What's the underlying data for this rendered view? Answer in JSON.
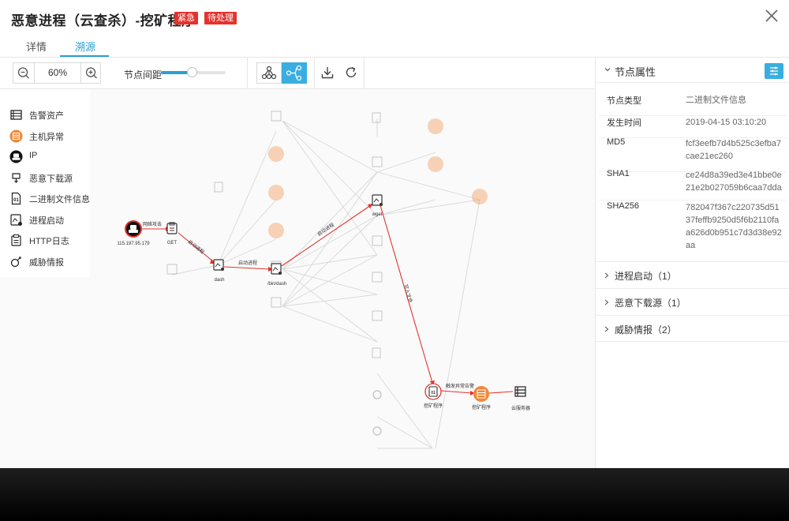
{
  "header": {
    "title": "恶意进程（云查杀）-挖矿程序",
    "tag_urgent": "紧急",
    "tag_pending": "待处理",
    "close_icon": "close-icon"
  },
  "tabs": [
    {
      "label": "详情",
      "active": false
    },
    {
      "label": "溯源",
      "active": true
    }
  ],
  "toolbar": {
    "zoom_value": "60%",
    "spacing_label": "节点间距",
    "slider_fraction": 0.48,
    "icons": [
      "zoom-out-icon",
      "zoom-in-icon",
      "tree-layout-icon",
      "graph-layout-icon",
      "download-icon",
      "refresh-icon"
    ]
  },
  "legend": [
    {
      "label": "告警资产",
      "icon": "asset-icon"
    },
    {
      "label": "主机异常",
      "icon": "host-anomaly-icon"
    },
    {
      "label": "IP",
      "icon": "ip-icon"
    },
    {
      "label": "恶意下载源",
      "icon": "download-source-icon"
    },
    {
      "label": "二进制文件信息",
      "icon": "binary-file-icon"
    },
    {
      "label": "进程启动",
      "icon": "process-start-icon"
    },
    {
      "label": "HTTP日志",
      "icon": "http-log-icon"
    },
    {
      "label": "威胁情报",
      "icon": "threat-intel-icon"
    }
  ],
  "graph": {
    "nodes": {
      "ip_node": "115.197.95.179",
      "get_node": "GET",
      "dash_node": "dash",
      "bindash_node": "/bin/dash",
      "wget_node": "wget",
      "miner_node": "挖矿程序",
      "host_anomaly_node": "挖矿程序",
      "asset_node": "云服务器"
    },
    "edges": {
      "network_attack": "网络攻击",
      "start_process_1": "启动进程",
      "start_process_2": "启动进程",
      "start_process_3": "启动进程",
      "write_file": "写入文件",
      "trigger_anomaly": "触发异常告警"
    }
  },
  "side_panel": {
    "title": "节点属性",
    "properties": [
      {
        "key": "节点类型",
        "value": "二进制文件信息"
      },
      {
        "key": "发生时间",
        "value": "2019-04-15 03:10:20"
      },
      {
        "key": "MD5",
        "value": "fcf3eefb7d4b525c3efba7cae21ec260"
      },
      {
        "key": "SHA1",
        "value": "ce24d8a39ed3e41bbe0e21e2b027059b6caa7dda"
      },
      {
        "key": "SHA256",
        "value": "782047f367c220735d5137feffb9250d5f6b2110faa626d0b951c7d3d38e92aa"
      }
    ],
    "sections": [
      {
        "label": "进程启动（1）"
      },
      {
        "label": "恶意下载源（1）"
      },
      {
        "label": "威胁情报（2）"
      }
    ]
  },
  "colors": {
    "accent": "#2a9fd6",
    "tag_red": "#e5322d",
    "edge_red": "#e5322d",
    "node_orange": "#f0883a"
  }
}
